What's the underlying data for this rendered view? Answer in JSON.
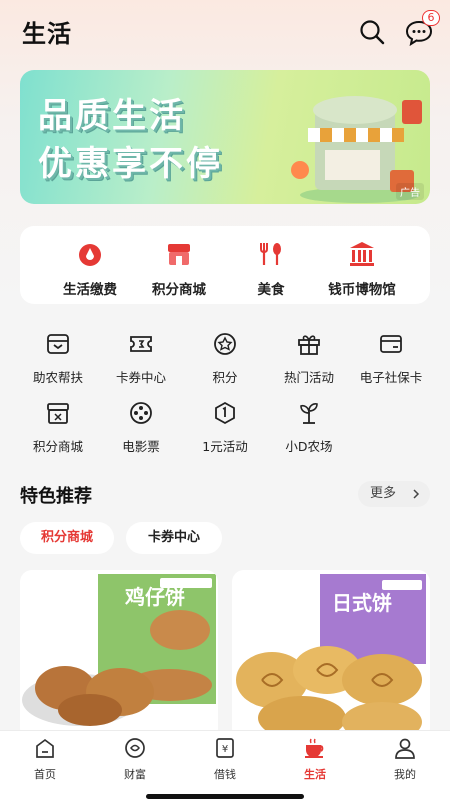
{
  "header": {
    "title": "生活",
    "message_badge": "6"
  },
  "banner": {
    "line1": "品质生活",
    "line2": "优惠享不停",
    "ad_label": "广告"
  },
  "quick_services": [
    {
      "label": "生活缴费",
      "icon": "drop-icon"
    },
    {
      "label": "积分商城",
      "icon": "store-icon"
    },
    {
      "label": "美食",
      "icon": "cutlery-icon"
    },
    {
      "label": "钱币博物馆",
      "icon": "museum-icon"
    }
  ],
  "grid": [
    {
      "label": "助农帮扶",
      "icon": "box-icon"
    },
    {
      "label": "卡券中心",
      "icon": "ticket-icon"
    },
    {
      "label": "积分",
      "icon": "badge-icon"
    },
    {
      "label": "热门活动",
      "icon": "gift-icon"
    },
    {
      "label": "电子社保卡",
      "icon": "card-icon"
    },
    {
      "label": "积分商城",
      "icon": "store-icon"
    },
    {
      "label": "电影票",
      "icon": "film-icon"
    },
    {
      "label": "1元活动",
      "icon": "coin-icon"
    },
    {
      "label": "小D农场",
      "icon": "sprout-icon"
    }
  ],
  "recommend": {
    "title": "特色推荐",
    "more": "更多",
    "chips": [
      "积分商城",
      "卡券中心"
    ]
  },
  "products": [
    {
      "name": "鸡仔饼"
    },
    {
      "name": "日式饼"
    }
  ],
  "tabbar": [
    {
      "label": "首页",
      "icon": "home-icon"
    },
    {
      "label": "财富",
      "icon": "wealth-icon"
    },
    {
      "label": "借钱",
      "icon": "loan-icon"
    },
    {
      "label": "生活",
      "icon": "life-icon"
    },
    {
      "label": "我的",
      "icon": "user-icon"
    }
  ],
  "colors": {
    "accent": "#e53935",
    "background": "#f5f5f5"
  }
}
